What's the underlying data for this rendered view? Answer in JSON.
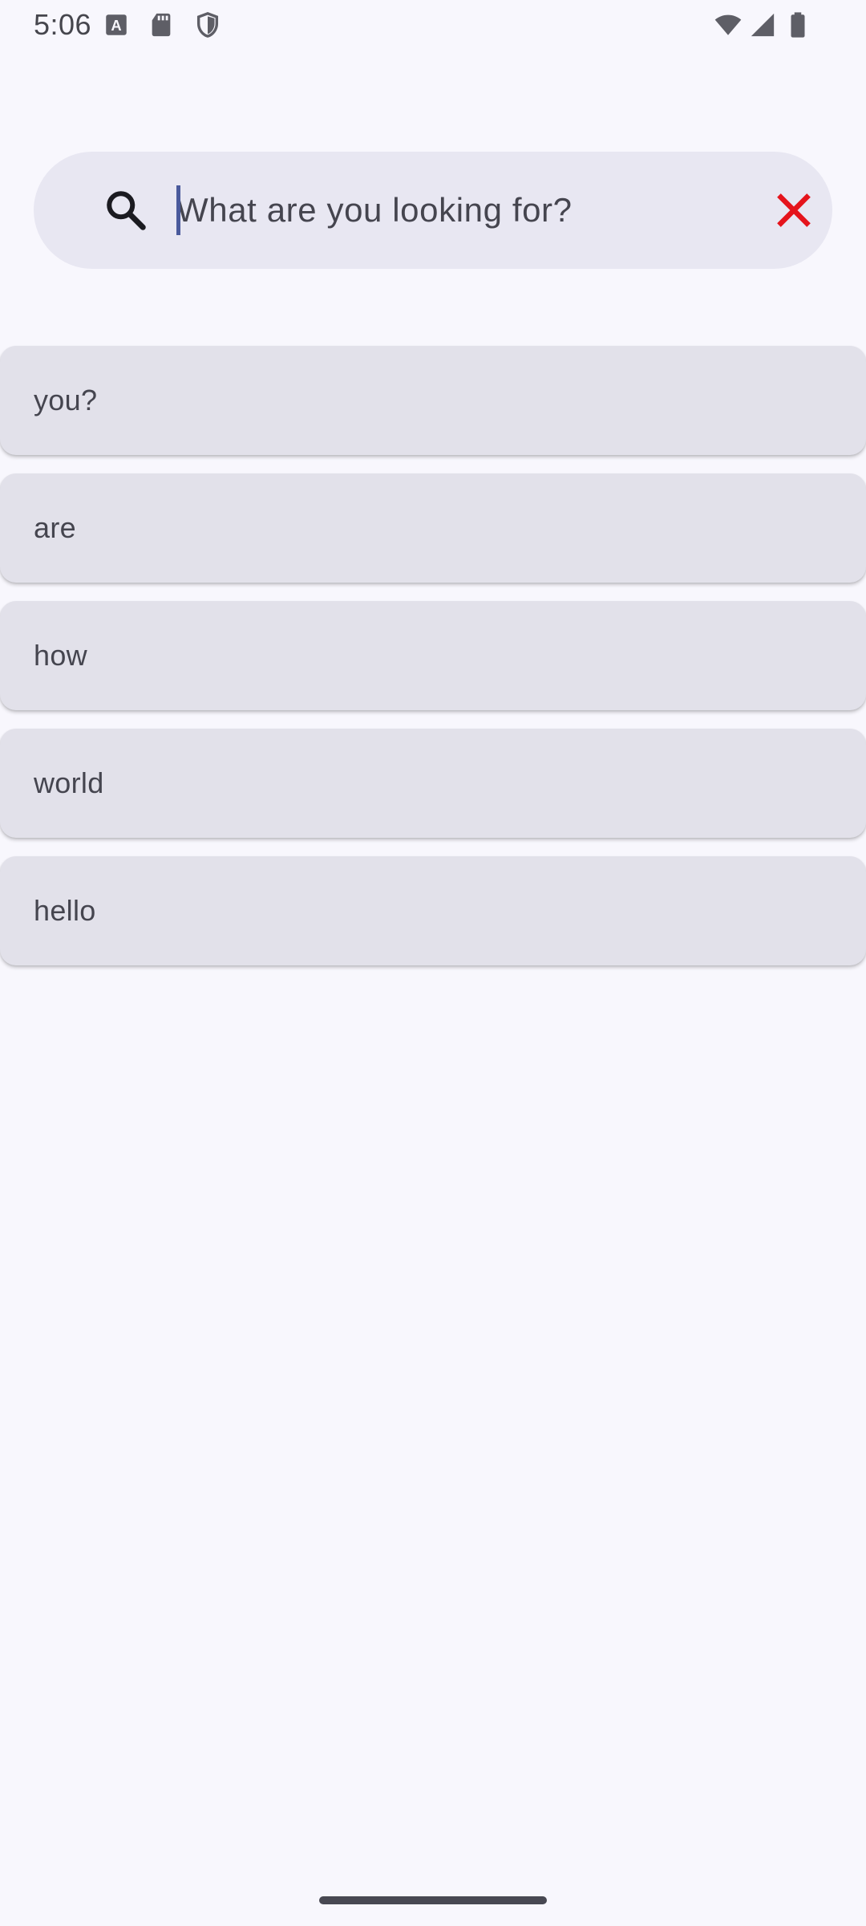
{
  "status_bar": {
    "time": "5:06",
    "left_icons": [
      "a-notification-icon",
      "sd-card-icon",
      "shield-icon"
    ],
    "right_icons": [
      "wifi-icon",
      "cell-signal-icon",
      "battery-icon"
    ]
  },
  "search": {
    "placeholder": "What are you looking for?",
    "value": ""
  },
  "results": [
    {
      "label": "you?"
    },
    {
      "label": "are"
    },
    {
      "label": "how"
    },
    {
      "label": "world"
    },
    {
      "label": "hello"
    }
  ],
  "colors": {
    "background": "#f8f7fd",
    "search_bar": "#e8e7f2",
    "list_item": "#e2e1ea",
    "text": "#45454f",
    "clear_icon": "#e5141c",
    "caret": "#4a5a9c"
  }
}
